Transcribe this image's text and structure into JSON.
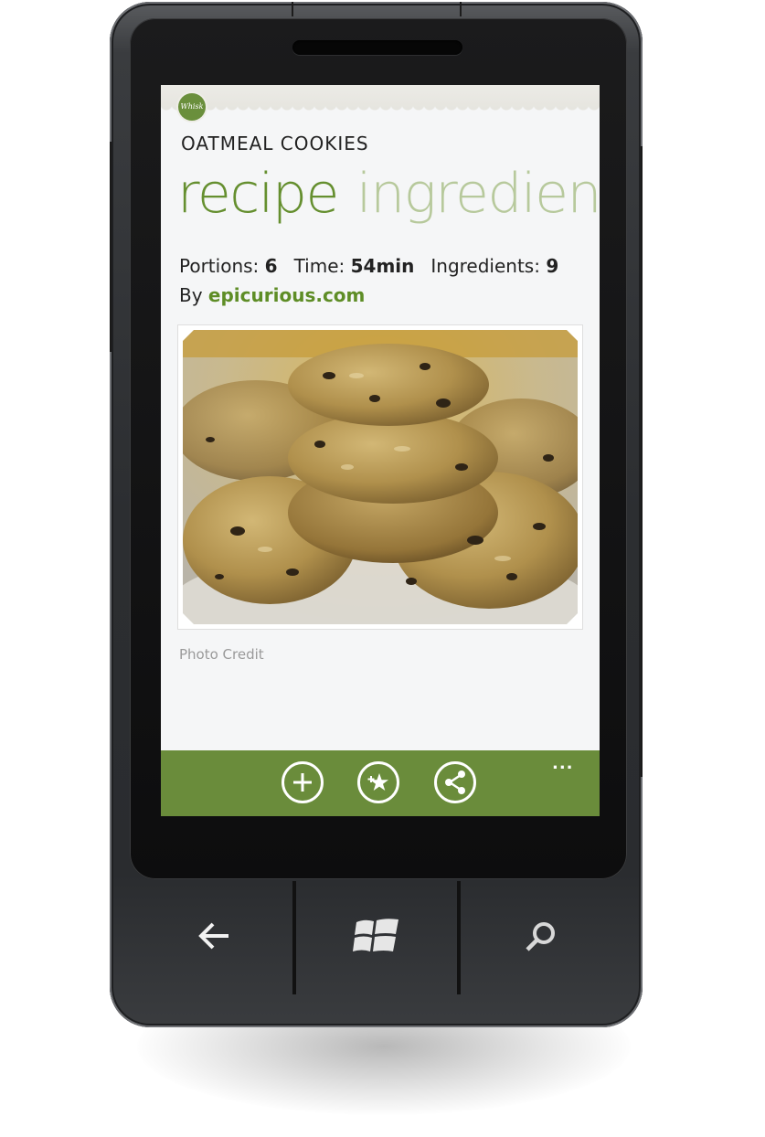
{
  "app": {
    "logo_text": "Whisk",
    "recipe_title": "OATMEAL COOKIES",
    "pivot": {
      "active": "recipe",
      "inactive": "ingredien"
    },
    "meta": {
      "portions_label": "Portions:",
      "portions_value": "6",
      "time_label": "Time:",
      "time_value": "54min",
      "ingredients_label": "Ingredients:",
      "ingredients_value": "9"
    },
    "source": {
      "prefix": "By",
      "link": "epicurious.com"
    },
    "photo_caption": "Photo Credit",
    "appbar": {
      "buttons": [
        {
          "icon": "add-icon"
        },
        {
          "icon": "favorite-star-icon"
        },
        {
          "icon": "share-icon"
        }
      ],
      "more": "..."
    }
  },
  "hardware_buttons": [
    "back-arrow-icon",
    "windows-logo-icon",
    "search-icon"
  ],
  "colors": {
    "accent": "#658f2f",
    "pivot_inactive": "#b7c99c",
    "appbar": "#6a8c3b",
    "link": "#5e8d26"
  }
}
